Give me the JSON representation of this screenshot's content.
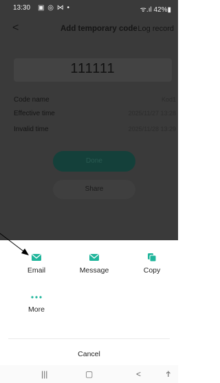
{
  "status_bar": {
    "time": "13:30",
    "notif_icons": "▣ ◎ ⋈ •",
    "right": "⁠ᯤ.ıl 42%▮"
  },
  "header": {
    "back": "<",
    "title": "Add temporary code",
    "log_record": "Log record"
  },
  "code": {
    "value": "111111"
  },
  "fields": [
    {
      "label": "Code name",
      "value": "Kod1"
    },
    {
      "label": "Effective time",
      "value": "2025/11/27 13:28"
    },
    {
      "label": "Invalid time",
      "value": "2025/11/28 13:29"
    }
  ],
  "buttons": {
    "done": "Done",
    "share": "Share"
  },
  "share_sheet": {
    "items": [
      {
        "label": "Email",
        "icon": "email-icon"
      },
      {
        "label": "Message",
        "icon": "message-icon"
      },
      {
        "label": "Copy",
        "icon": "copy-icon"
      },
      {
        "label": "More",
        "icon": "more-dots-icon"
      }
    ],
    "cancel": "Cancel",
    "accent_color": "#1fb59b"
  },
  "system_nav": {
    "recents": "|||",
    "home": "▢",
    "back": "<",
    "accessibility": "Ϯ"
  }
}
